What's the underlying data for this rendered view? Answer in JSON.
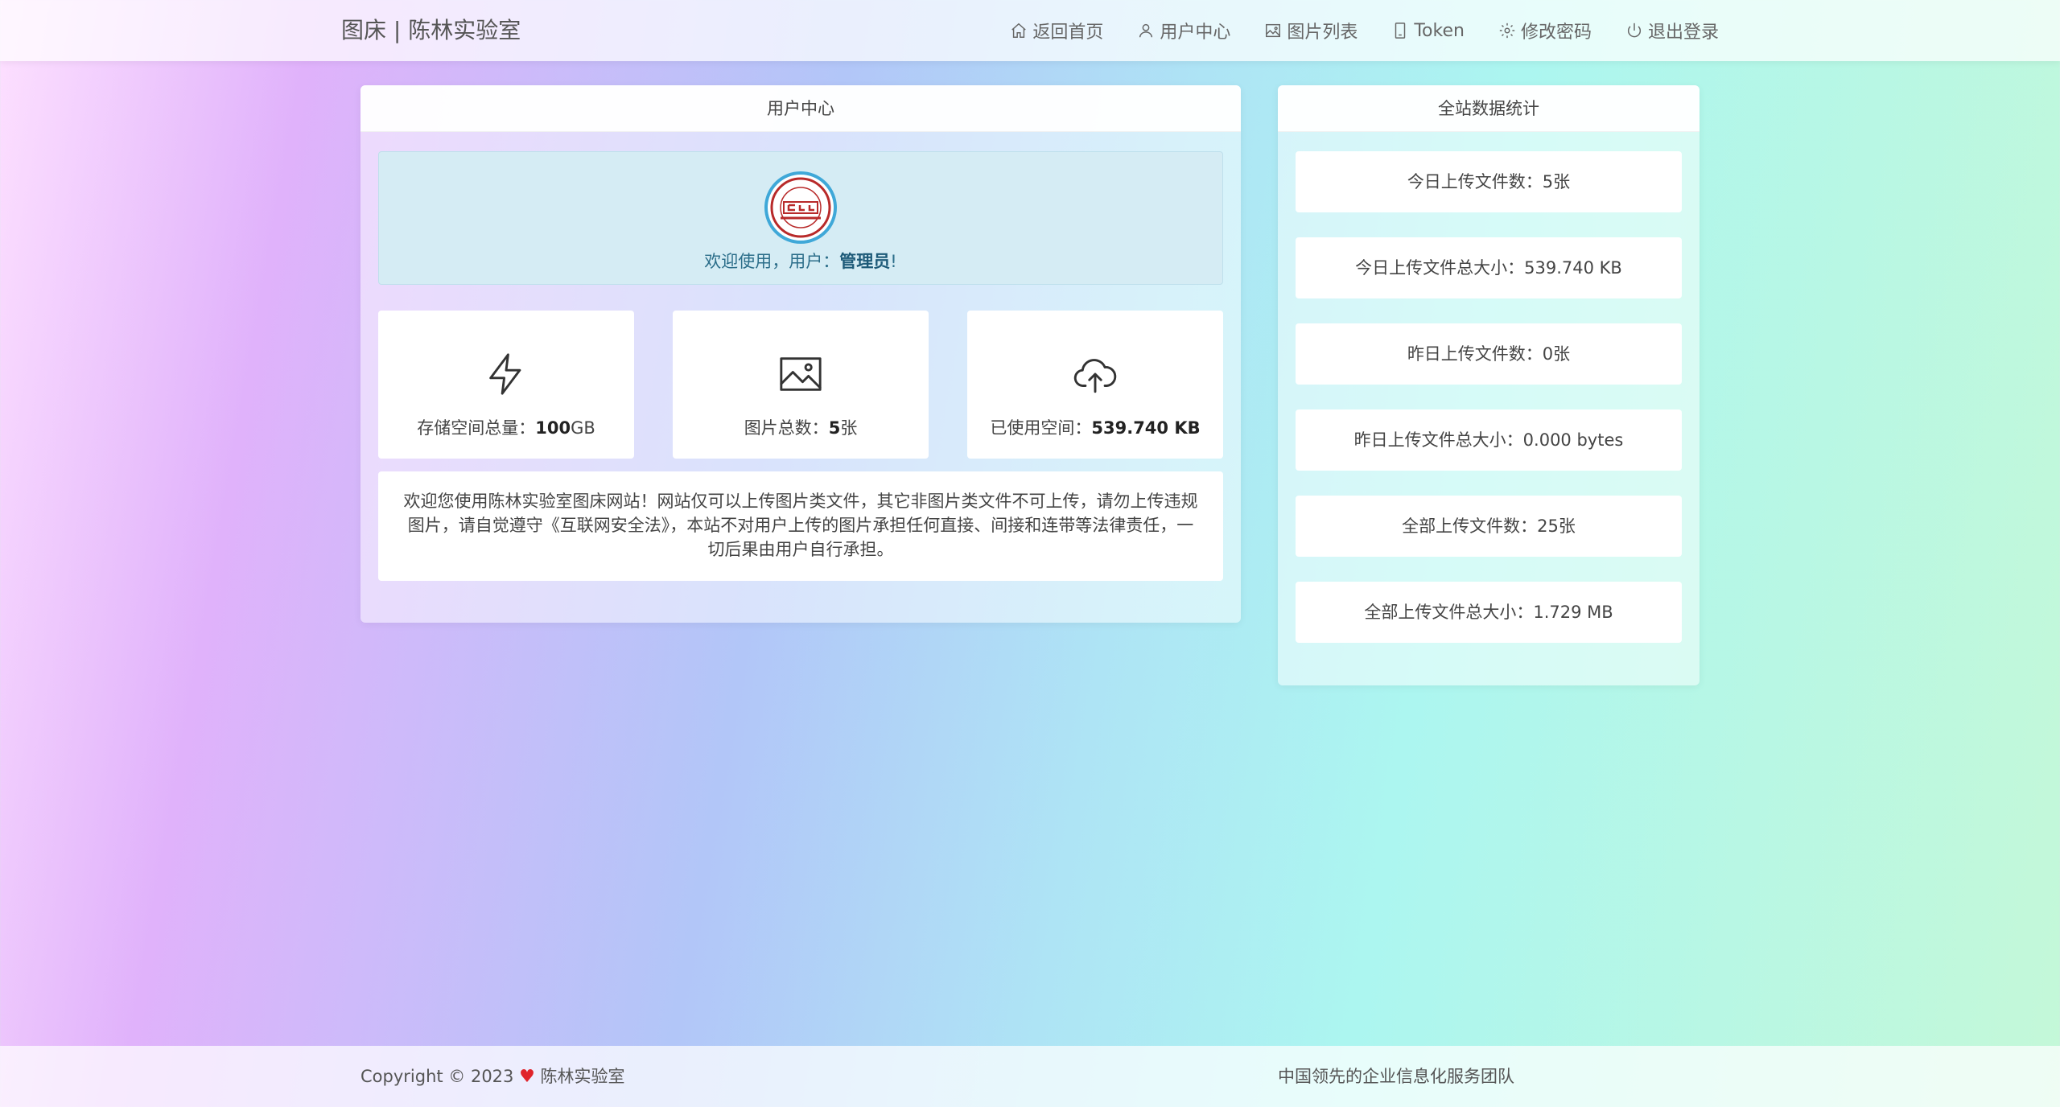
{
  "brand": "图床 | 陈林实验室",
  "nav": [
    {
      "icon": "home-icon",
      "label": "返回首页"
    },
    {
      "icon": "user-icon",
      "label": "用户中心"
    },
    {
      "icon": "image-icon",
      "label": "图片列表"
    },
    {
      "icon": "phone-icon",
      "label": "Token"
    },
    {
      "icon": "gear-icon",
      "label": "修改密码"
    },
    {
      "icon": "power-icon",
      "label": "退出登录"
    }
  ],
  "user_center": {
    "title": "用户中心",
    "welcome_prefix": "欢迎使用，用户：",
    "username": "管理员",
    "welcome_suffix": "!",
    "stats": [
      {
        "icon": "lightning-icon",
        "label": "存储空间总量：",
        "value": "100",
        "unit": "GB"
      },
      {
        "icon": "image-icon",
        "label": "图片总数：",
        "value": "5",
        "unit": "张"
      },
      {
        "icon": "cloud-upload-icon",
        "label": "已使用空间：",
        "value": "539.740 KB",
        "unit": ""
      }
    ],
    "notice": "欢迎您使用陈林实验室图床网站！网站仅可以上传图片类文件，其它非图片类文件不可上传，请勿上传违规图片，请自觉遵守《互联网安全法》，本站不对用户上传的图片承担任何直接、间接和连带等法律责任，一切后果由用户自行承担。"
  },
  "site_stats": {
    "title": "全站数据统计",
    "rows": [
      "今日上传文件数：5张",
      "今日上传文件总大小：539.740 KB",
      "昨日上传文件数：0张",
      "昨日上传文件总大小：0.000 bytes",
      "全部上传文件数：25张",
      "全部上传文件总大小：1.729 MB"
    ]
  },
  "footer": {
    "copyright": "Copyright © 2023",
    "owner": "陈林实验室",
    "slogan": "中国领先的企业信息化服务团队"
  },
  "colors": {
    "heart": "#e0242b",
    "welcome_bg": "#d5ecf4",
    "welcome_text": "#2c6e8a"
  }
}
